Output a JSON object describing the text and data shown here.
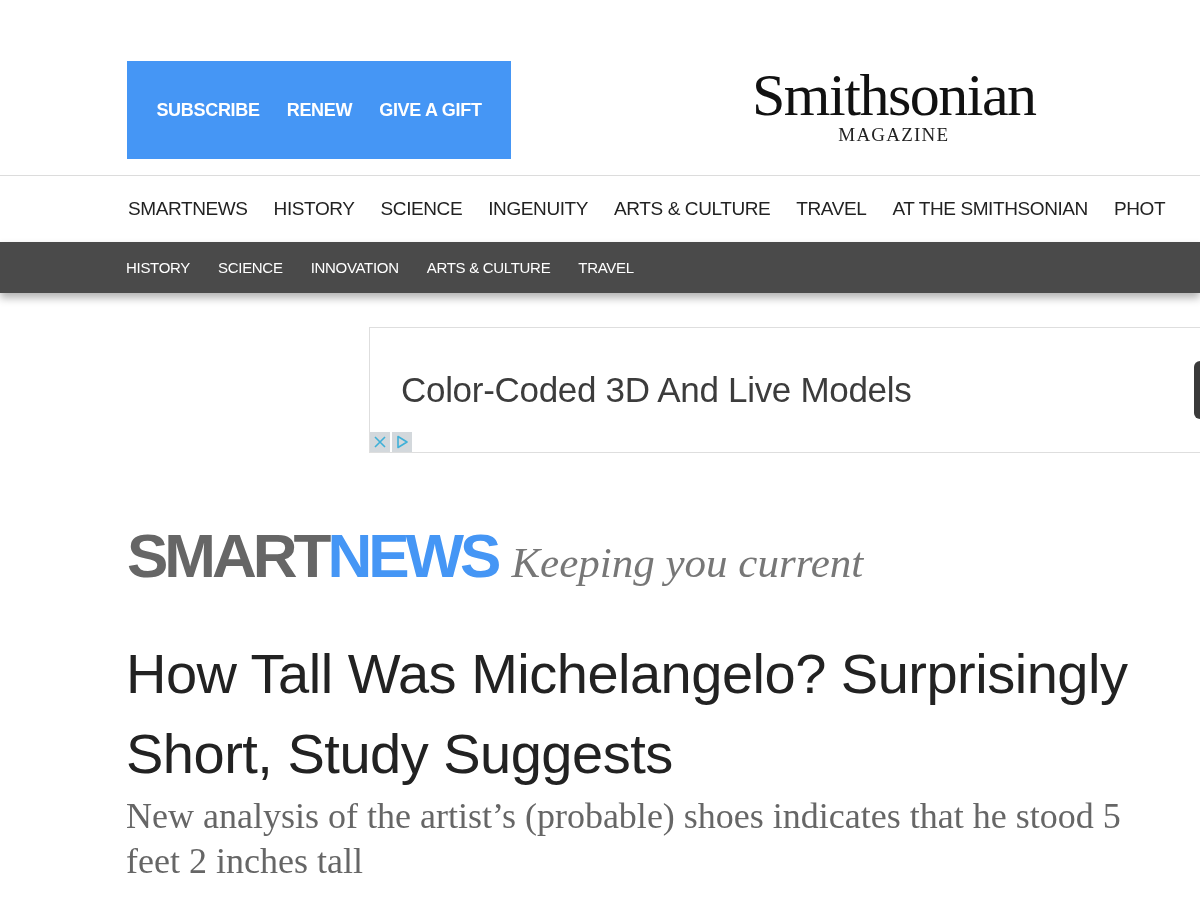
{
  "header": {
    "links": [
      "SUBSCRIBE",
      "RENEW",
      "GIVE A GIFT"
    ],
    "logo": {
      "name": "Smithsonian",
      "subtitle": "MAGAZINE"
    }
  },
  "main_nav": {
    "items": [
      "SMARTNEWS",
      "HISTORY",
      "SCIENCE",
      "INGENUITY",
      "ARTS & CULTURE",
      "TRAVEL",
      "AT THE SMITHSONIAN",
      "PHOT"
    ]
  },
  "sub_nav": {
    "items": [
      "HISTORY",
      "SCIENCE",
      "INNOVATION",
      "ARTS & CULTURE",
      "TRAVEL"
    ]
  },
  "ad": {
    "headline": "Color-Coded 3D And Live Models"
  },
  "section": {
    "name_parts": [
      {
        "text": "SMART",
        "color": "#666666"
      },
      {
        "text": "NEWS",
        "color": "#4596f5"
      }
    ],
    "tagline": "Keeping you current"
  },
  "article": {
    "title": "How Tall Was Michelangelo? Surprisingly Short, Study Suggests",
    "dek": "New analysis of the artist’s (probable) shoes indicates that he stood 5 feet 2 inches tall"
  }
}
